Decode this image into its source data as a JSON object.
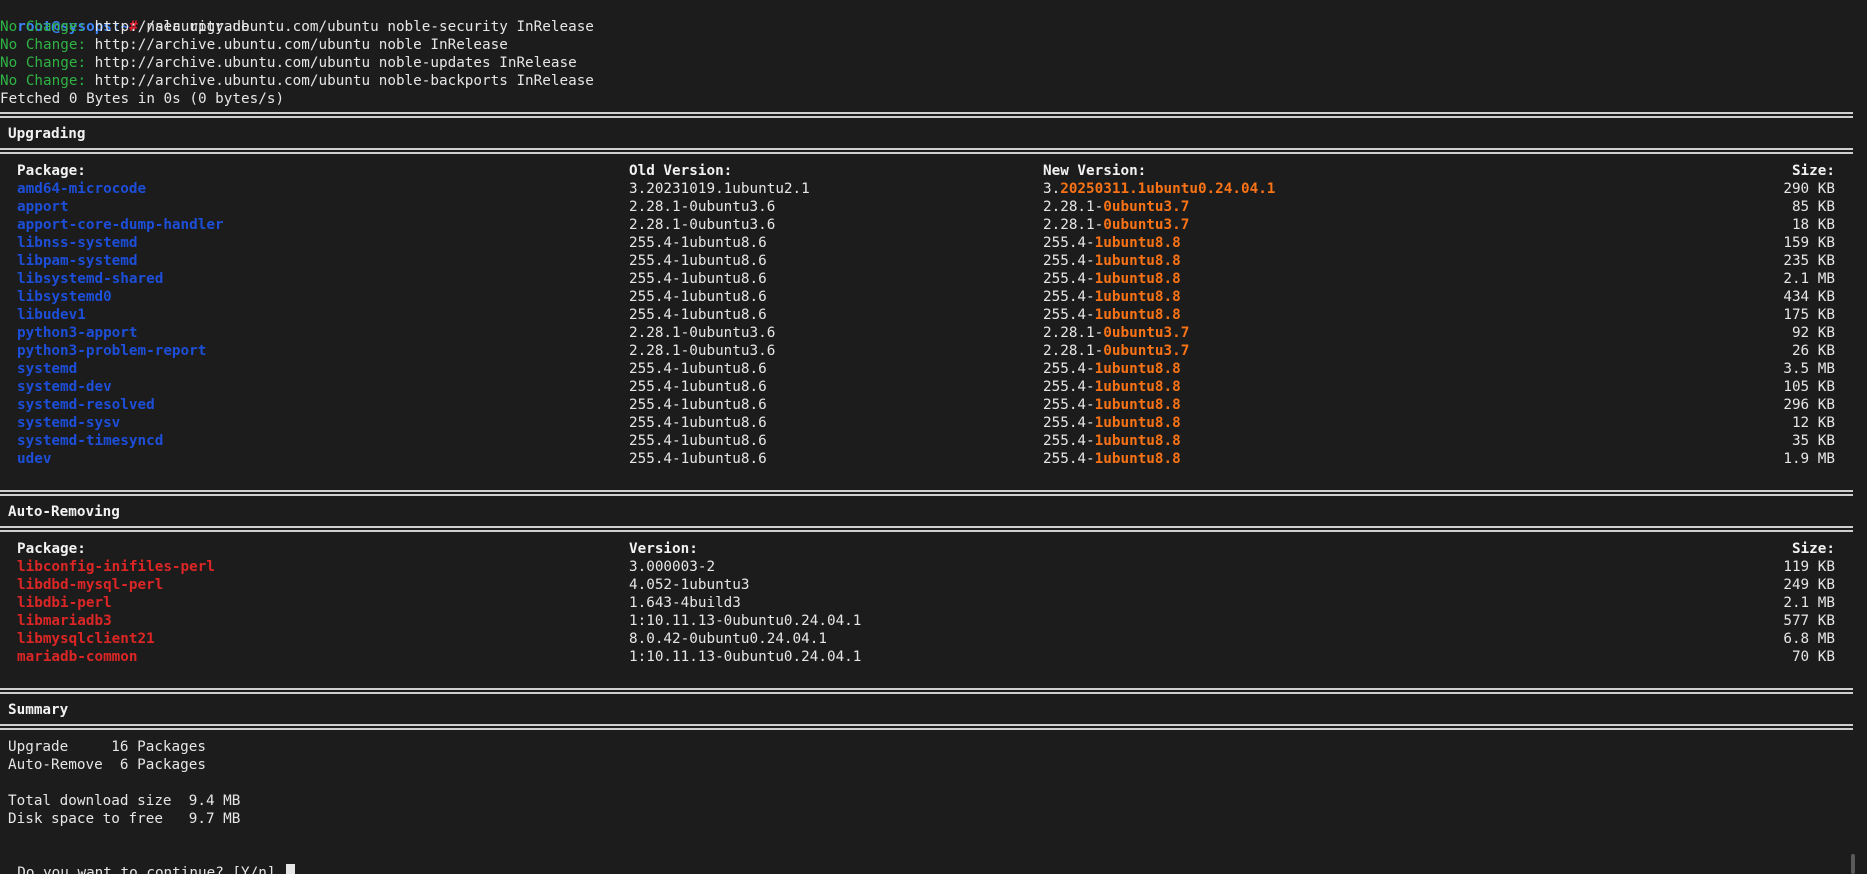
{
  "prompt": {
    "user": "root",
    "at": "@",
    "host": "sysops",
    "path": ":~",
    "symbol": "#",
    "command": " nala upgrade"
  },
  "repo_lines": [
    {
      "label": "No Change:",
      "text": " http://security.ubuntu.com/ubuntu noble-security InRelease"
    },
    {
      "label": "No Change:",
      "text": " http://archive.ubuntu.com/ubuntu noble InRelease"
    },
    {
      "label": "No Change:",
      "text": " http://archive.ubuntu.com/ubuntu noble-updates InRelease"
    },
    {
      "label": "No Change:",
      "text": " http://archive.ubuntu.com/ubuntu noble-backports InRelease"
    }
  ],
  "fetched": "Fetched 0 Bytes in 0s (0 bytes/s)",
  "upgrading": {
    "title": "Upgrading",
    "headers": {
      "package": "Package:",
      "old": "Old Version:",
      "new": "New Version:",
      "size": "Size:"
    },
    "rows": [
      {
        "pkg": "amd64-microcode",
        "old": "3.20231019.1ubuntu2.1",
        "new_base": "3.",
        "new_hl": "20250311.1ubuntu0.24.04.1",
        "size": "290 KB"
      },
      {
        "pkg": "apport",
        "old": "2.28.1-0ubuntu3.6",
        "new_base": "2.28.1-",
        "new_hl": "0ubuntu3.7",
        "size": "85 KB"
      },
      {
        "pkg": "apport-core-dump-handler",
        "old": "2.28.1-0ubuntu3.6",
        "new_base": "2.28.1-",
        "new_hl": "0ubuntu3.7",
        "size": "18 KB"
      },
      {
        "pkg": "libnss-systemd",
        "old": "255.4-1ubuntu8.6",
        "new_base": "255.4-",
        "new_hl": "1ubuntu8.8",
        "size": "159 KB"
      },
      {
        "pkg": "libpam-systemd",
        "old": "255.4-1ubuntu8.6",
        "new_base": "255.4-",
        "new_hl": "1ubuntu8.8",
        "size": "235 KB"
      },
      {
        "pkg": "libsystemd-shared",
        "old": "255.4-1ubuntu8.6",
        "new_base": "255.4-",
        "new_hl": "1ubuntu8.8",
        "size": "2.1 MB"
      },
      {
        "pkg": "libsystemd0",
        "old": "255.4-1ubuntu8.6",
        "new_base": "255.4-",
        "new_hl": "1ubuntu8.8",
        "size": "434 KB"
      },
      {
        "pkg": "libudev1",
        "old": "255.4-1ubuntu8.6",
        "new_base": "255.4-",
        "new_hl": "1ubuntu8.8",
        "size": "175 KB"
      },
      {
        "pkg": "python3-apport",
        "old": "2.28.1-0ubuntu3.6",
        "new_base": "2.28.1-",
        "new_hl": "0ubuntu3.7",
        "size": "92 KB"
      },
      {
        "pkg": "python3-problem-report",
        "old": "2.28.1-0ubuntu3.6",
        "new_base": "2.28.1-",
        "new_hl": "0ubuntu3.7",
        "size": "26 KB"
      },
      {
        "pkg": "systemd",
        "old": "255.4-1ubuntu8.6",
        "new_base": "255.4-",
        "new_hl": "1ubuntu8.8",
        "size": "3.5 MB"
      },
      {
        "pkg": "systemd-dev",
        "old": "255.4-1ubuntu8.6",
        "new_base": "255.4-",
        "new_hl": "1ubuntu8.8",
        "size": "105 KB"
      },
      {
        "pkg": "systemd-resolved",
        "old": "255.4-1ubuntu8.6",
        "new_base": "255.4-",
        "new_hl": "1ubuntu8.8",
        "size": "296 KB"
      },
      {
        "pkg": "systemd-sysv",
        "old": "255.4-1ubuntu8.6",
        "new_base": "255.4-",
        "new_hl": "1ubuntu8.8",
        "size": "12 KB"
      },
      {
        "pkg": "systemd-timesyncd",
        "old": "255.4-1ubuntu8.6",
        "new_base": "255.4-",
        "new_hl": "1ubuntu8.8",
        "size": "35 KB"
      },
      {
        "pkg": "udev",
        "old": "255.4-1ubuntu8.6",
        "new_base": "255.4-",
        "new_hl": "1ubuntu8.8",
        "size": "1.9 MB"
      }
    ]
  },
  "autoremoving": {
    "title": "Auto-Removing",
    "headers": {
      "package": "Package:",
      "version": "Version:",
      "size": "Size:"
    },
    "rows": [
      {
        "pkg": "libconfig-inifiles-perl",
        "version": "3.000003-2",
        "size": "119 KB"
      },
      {
        "pkg": "libdbd-mysql-perl",
        "version": "4.052-1ubuntu3",
        "size": "249 KB"
      },
      {
        "pkg": "libdbi-perl",
        "version": "1.643-4build3",
        "size": "2.1 MB"
      },
      {
        "pkg": "libmariadb3",
        "version": "1:10.11.13-0ubuntu0.24.04.1",
        "size": "577 KB"
      },
      {
        "pkg": "libmysqlclient21",
        "version": "8.0.42-0ubuntu0.24.04.1",
        "size": "6.8 MB"
      },
      {
        "pkg": "mariadb-common",
        "version": "1:10.11.13-0ubuntu0.24.04.1",
        "size": "70 KB"
      }
    ]
  },
  "summary": {
    "title": "Summary",
    "upgrade_line": "Upgrade     16 Packages",
    "remove_line": "Auto-Remove  6 Packages",
    "download_line": "Total download size  9.4 MB",
    "disk_line": "Disk space to free   9.7 MB"
  },
  "question": "Do you want to continue? [Y/n] ",
  "colors": {
    "package_upgrade": "#1d4ed8",
    "package_remove": "#dc2626",
    "version_highlight": "#f97316",
    "no_change": "#2fb344"
  }
}
